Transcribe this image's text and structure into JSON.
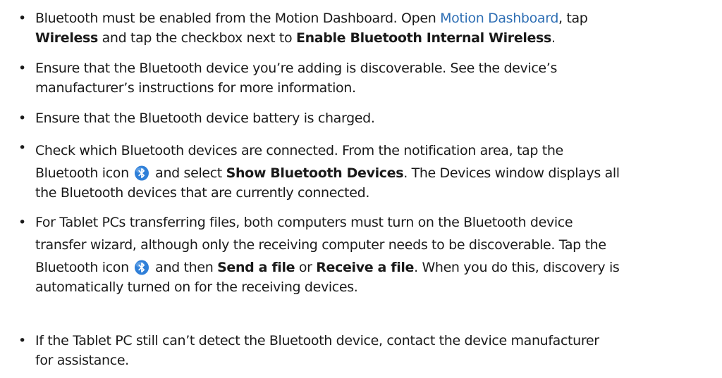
{
  "bullets": [
    {
      "l1_a": "Bluetooth must be enabled from the Motion Dashboard. Open ",
      "l1_link": "Motion Dashboard",
      "l1_b": ", tap",
      "l2_bold1": "Wireless",
      "l2_a": " and tap the checkbox next to ",
      "l2_bold2": "Enable Bluetooth Internal Wireless",
      "l2_b": "."
    },
    {
      "l1": "Ensure that the Bluetooth device you’re adding is discoverable. See the device’s",
      "l2": "manufacturer’s instructions for more information."
    },
    {
      "l1": "Ensure that the Bluetooth device battery is charged."
    },
    {
      "l1": "Check which Bluetooth devices are connected. From the notification area, tap the",
      "l2_a": "Bluetooth icon",
      "l2_b": " and select ",
      "l2_bold": "Show Bluetooth Devices",
      "l2_c": ". The Devices window displays all",
      "l3": "the Bluetooth devices that are currently connected."
    },
    {
      "l1": "For Tablet PCs transferring files, both computers must turn on the Bluetooth device",
      "l2": "transfer wizard, although only the receiving computer needs to be discoverable. Tap the",
      "l3_a": "Bluetooth icon",
      "l3_b": " and then ",
      "l3_bold1": "Send a file",
      "l3_c": " or ",
      "l3_bold2": "Receive a file",
      "l3_d": ". When you do this, discovery is",
      "l4": "automatically turned on for the receiving devices."
    },
    {
      "l1": "If the Tablet PC still can’t detect the Bluetooth device, contact the device manufacturer",
      "l2": "for assistance."
    }
  ],
  "bullet_char": "•",
  "icons": {
    "bluetooth": "bluetooth-icon",
    "bluetooth_color": "#2f7fd8"
  },
  "colors": {
    "link": "#2f6fb4",
    "text": "#1a1a1a"
  }
}
